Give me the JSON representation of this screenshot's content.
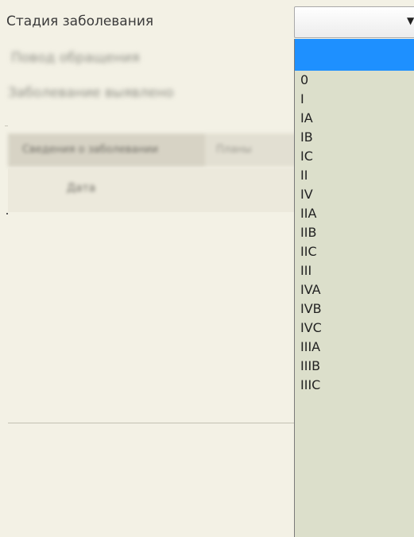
{
  "field": {
    "label": "Стадия заболевания",
    "selected_value": "",
    "arrow_icon": "▼"
  },
  "background_form": {
    "obscured_labels": [
      "Повод обращения",
      "Заболевание выявлено"
    ],
    "tabs": [
      "Сведения о заболевании",
      "Планы"
    ],
    "column_header": "Дата"
  },
  "dropdown": {
    "options": [
      "",
      "0",
      "I",
      "IA",
      "IB",
      "IC",
      "II",
      "IV",
      "IIA",
      "IIB",
      "IIC",
      "III",
      "IVA",
      "IVB",
      "IVC",
      "IIIA",
      "IIIB",
      "IIIC"
    ],
    "selected_index": 0,
    "colors": {
      "highlight": "#1e90ff",
      "list_background": "#dcdfcb"
    }
  },
  "colors": {
    "page_background": "#f3f1e5"
  }
}
